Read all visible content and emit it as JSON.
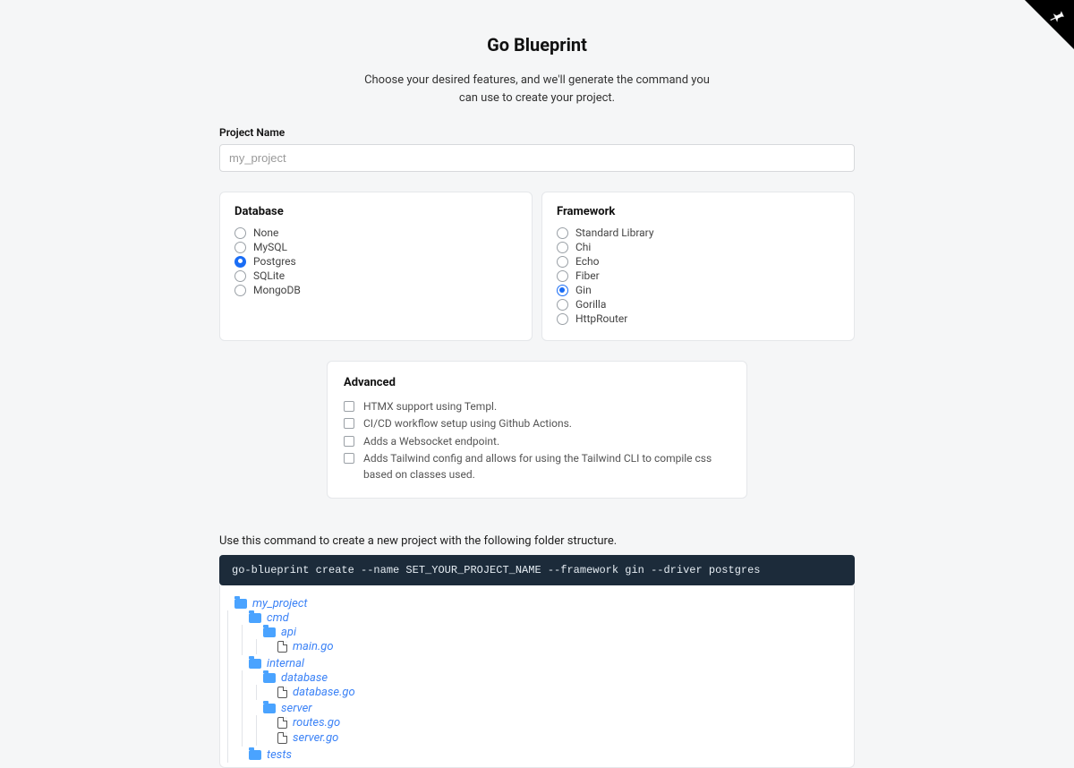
{
  "header": {
    "title": "Go Blueprint",
    "subtitle": "Choose your desired features, and we'll generate the command you can use to create your project."
  },
  "project": {
    "label": "Project Name",
    "placeholder": "my_project",
    "value": ""
  },
  "database": {
    "title": "Database",
    "options": [
      {
        "label": "None",
        "selected": false
      },
      {
        "label": "MySQL",
        "selected": false
      },
      {
        "label": "Postgres",
        "selected": true,
        "variant": "filled"
      },
      {
        "label": "SQLite",
        "selected": false
      },
      {
        "label": "MongoDB",
        "selected": false
      }
    ]
  },
  "framework": {
    "title": "Framework",
    "options": [
      {
        "label": "Standard Library",
        "selected": false
      },
      {
        "label": "Chi",
        "selected": false
      },
      {
        "label": "Echo",
        "selected": false
      },
      {
        "label": "Fiber",
        "selected": false
      },
      {
        "label": "Gin",
        "selected": true,
        "variant": "outline"
      },
      {
        "label": "Gorilla",
        "selected": false
      },
      {
        "label": "HttpRouter",
        "selected": false
      }
    ]
  },
  "advanced": {
    "title": "Advanced",
    "options": [
      {
        "label": "HTMX support using Templ.",
        "checked": false
      },
      {
        "label": "CI/CD workflow setup using Github Actions.",
        "checked": false
      },
      {
        "label": "Adds a Websocket endpoint.",
        "checked": false
      },
      {
        "label": "Adds Tailwind config and allows for using the Tailwind CLI to compile css based on classes used.",
        "checked": false
      }
    ]
  },
  "command": {
    "note": "Use this command to create a new project with the following folder structure.",
    "text": "go-blueprint create --name SET_YOUR_PROJECT_NAME --framework gin --driver postgres"
  },
  "tree": {
    "root": "my_project",
    "cmd": "cmd",
    "api": "api",
    "main_go": "main.go",
    "internal": "internal",
    "database_dir": "database",
    "database_go": "database.go",
    "server_dir": "server",
    "routes_go": "routes.go",
    "server_go": "server.go",
    "tests": "tests"
  }
}
